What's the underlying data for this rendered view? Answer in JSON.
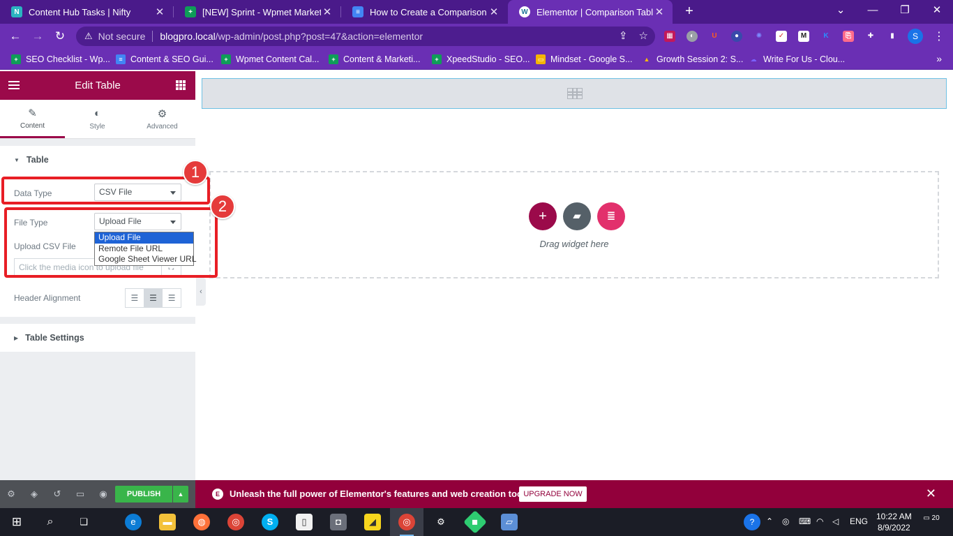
{
  "browser": {
    "tabs": [
      {
        "title": "Content Hub Tasks | Nifty",
        "icon": "nifty-icon",
        "color": "#2bb3c0"
      },
      {
        "title": "[NEW] Sprint - Wpmet Marketing",
        "icon": "sheets-icon",
        "color": "#0f9d58"
      },
      {
        "title": "How to Create a Comparison Tab",
        "icon": "docs-icon",
        "color": "#4285f4"
      },
      {
        "title": "Elementor | Comparison Table",
        "icon": "wordpress-icon",
        "color": "#21759b"
      }
    ],
    "address": {
      "security_label": "Not secure",
      "host": "blogpro.local",
      "path": "/wp-admin/post.php?post=47&action=elementor"
    },
    "profile_initial": "S",
    "bookmarks": [
      {
        "label": "SEO Checklist - Wp...",
        "color": "#0f9d58"
      },
      {
        "label": "Content & SEO Gui...",
        "color": "#4285f4"
      },
      {
        "label": "Wpmet Content Cal...",
        "color": "#0f9d58"
      },
      {
        "label": "Content & Marketi...",
        "color": "#0f9d58"
      },
      {
        "label": "XpeedStudio - SEO...",
        "color": "#0f9d58"
      },
      {
        "label": "Mindset - Google S...",
        "color": "#f4b400"
      },
      {
        "label": "Growth Session 2: S...",
        "color": "#34a853"
      },
      {
        "label": "Write For Us - Clou...",
        "color": "#6c4de6"
      }
    ]
  },
  "panel": {
    "title": "Edit Table",
    "tabs": [
      {
        "label": "Content",
        "icon": "pencil-icon"
      },
      {
        "label": "Style",
        "icon": "half-circle-icon"
      },
      {
        "label": "Advanced",
        "icon": "gear-icon"
      }
    ],
    "section_table": "Table",
    "data_type": {
      "label": "Data Type",
      "value": "CSV File"
    },
    "file_type": {
      "label": "File Type",
      "value": "Upload File",
      "options": [
        "Upload File",
        "Remote File URL",
        "Google Sheet Viewer URL"
      ]
    },
    "upload_csv": {
      "label": "Upload CSV File",
      "placeholder": "Click the media icon to upload file"
    },
    "header_alignment": {
      "label": "Header Alignment"
    },
    "section_settings": "Table Settings",
    "publish_label": "PUBLISH"
  },
  "annotations": [
    "1",
    "2"
  ],
  "canvas": {
    "drag_text": "Drag widget here"
  },
  "banner": {
    "text": "Unleash the full power of Elementor's features and web creation tools.",
    "button": "UPGRADE NOW"
  },
  "taskbar": {
    "language": "ENG",
    "time": "10:22 AM",
    "date": "8/9/2022",
    "notifications": "20"
  },
  "colors": {
    "elementor_accent": "#9b0a4a",
    "browser_theme": "#6a2fb4",
    "publish_green": "#39b54a",
    "annotation_red": "#e81e25"
  }
}
